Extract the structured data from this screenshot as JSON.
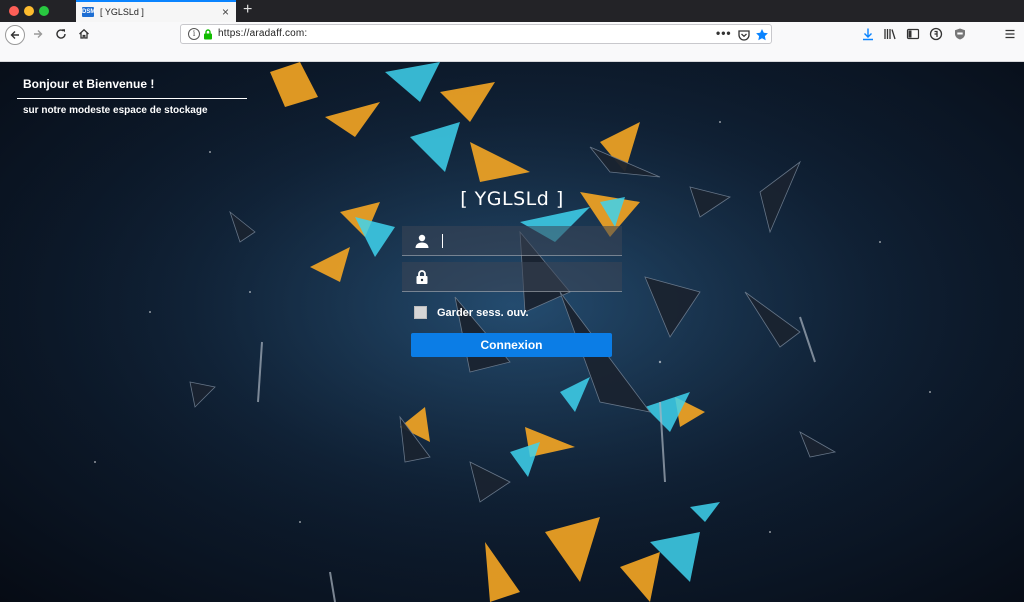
{
  "browser": {
    "tab": {
      "favicon_text": "DSM",
      "title": "[ YGLSLd ]"
    },
    "url": "https://aradaff.com:",
    "accent_color": "#0a84ff"
  },
  "page": {
    "welcome_title": "Bonjour et Bienvenue !",
    "welcome_subtitle": "sur notre modeste espace de stockage",
    "brand": "[ YGLSLd ]",
    "username_value": "",
    "password_value": "",
    "remember_label": "Garder sess. ouv.",
    "remember_checked": false,
    "login_button": "Connexion",
    "button_color": "#0b7de6"
  },
  "icons": {
    "nav": [
      "back-arrow-icon",
      "forward-arrow-icon",
      "reload-icon",
      "home-icon"
    ],
    "urlbar": [
      "info-icon",
      "lock-icon",
      "more-actions-icon",
      "pocket-icon",
      "bookmark-star-icon"
    ],
    "toolbar": [
      "download-icon",
      "library-icon",
      "sidebar-icon",
      "account-icon",
      "shield-icon",
      "menu-icon"
    ],
    "fields": [
      "user-icon",
      "password-lock-icon"
    ]
  }
}
